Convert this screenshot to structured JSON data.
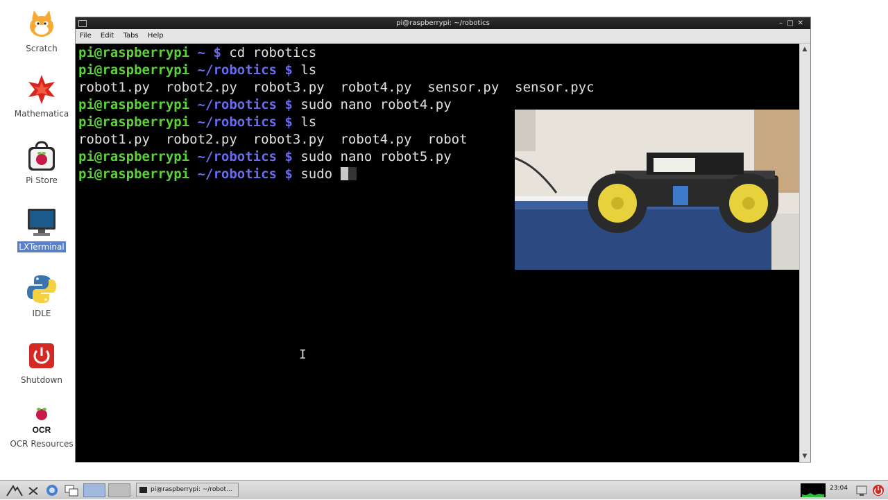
{
  "desktop": {
    "icons": [
      {
        "label": "Scratch"
      },
      {
        "label": "Mathematica"
      },
      {
        "label": "Pi Store"
      },
      {
        "label": "LXTerminal"
      },
      {
        "label": "IDLE"
      },
      {
        "label": "Shutdown"
      },
      {
        "label": "OCR Resources"
      }
    ],
    "ocr_logo_text": "OCR"
  },
  "window": {
    "title": "pi@raspberrypi: ~/robotics",
    "menu": [
      "File",
      "Edit",
      "Tabs",
      "Help"
    ]
  },
  "terminal": {
    "lines": [
      {
        "user": "pi@raspberrypi",
        "path": " ~ $",
        "text": " cd robotics"
      },
      {
        "user": "pi@raspberrypi",
        "path": " ~/robotics $",
        "text": " ls"
      },
      {
        "user": "",
        "path": "",
        "text": "robot1.py  robot2.py  robot3.py  robot4.py  sensor.py  sensor.pyc"
      },
      {
        "user": "pi@raspberrypi",
        "path": " ~/robotics $",
        "text": " sudo nano robot4.py"
      },
      {
        "user": "pi@raspberrypi",
        "path": " ~/robotics $",
        "text": " ls"
      },
      {
        "user": "",
        "path": "",
        "text": "robot1.py  robot2.py  robot3.py  robot4.py  robot"
      },
      {
        "user": "pi@raspberrypi",
        "path": " ~/robotics $",
        "text": " sudo nano robot5.py"
      },
      {
        "user": "pi@raspberrypi",
        "path": " ~/robotics $",
        "text": " sudo "
      }
    ]
  },
  "taskbar": {
    "task_label": "pi@raspberrypi: ~/robot...",
    "clock": "23:04"
  },
  "colors": {
    "prompt_user": "#5bd23a",
    "prompt_path": "#6a6cf0",
    "terminal_bg": "#000000"
  }
}
